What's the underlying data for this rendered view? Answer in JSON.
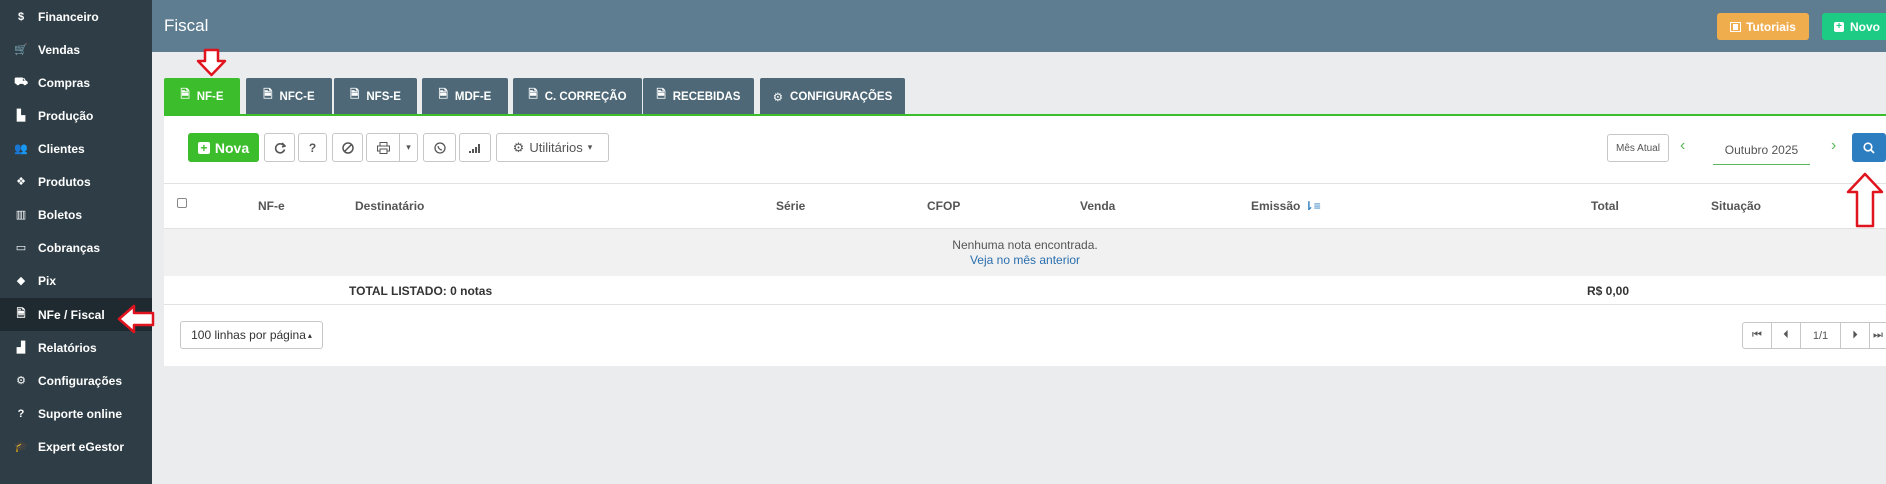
{
  "sidebar": {
    "items": [
      {
        "label": "Financeiro",
        "icon": "$"
      },
      {
        "label": "Vendas",
        "icon": "🛒"
      },
      {
        "label": "Compras",
        "icon": "⛟"
      },
      {
        "label": "Produção",
        "icon": "▙"
      },
      {
        "label": "Clientes",
        "icon": "👥"
      },
      {
        "label": "Produtos",
        "icon": "❖"
      },
      {
        "label": "Boletos",
        "icon": "▥"
      },
      {
        "label": "Cobranças",
        "icon": "▭"
      },
      {
        "label": "Pix",
        "icon": "◆"
      },
      {
        "label": "NFe / Fiscal",
        "icon": "🗎"
      },
      {
        "label": "Relatórios",
        "icon": "▟"
      },
      {
        "label": "Configurações",
        "icon": "⚙"
      },
      {
        "label": "Suporte online",
        "icon": "?"
      },
      {
        "label": "Expert eGestor",
        "icon": "🎓"
      }
    ]
  },
  "header": {
    "title": "Fiscal",
    "tutoriais_label": "Tutoriais",
    "novo_label": "Novo"
  },
  "tabs": [
    {
      "label": "NF-E"
    },
    {
      "label": "NFC-E"
    },
    {
      "label": "NFS-E"
    },
    {
      "label": "MDF-E"
    },
    {
      "label": "C. CORREÇÃO"
    },
    {
      "label": "RECEBIDAS"
    },
    {
      "label": "CONFIGURAÇÕES"
    }
  ],
  "toolbar": {
    "nova_label": "Nova",
    "help_label": "?",
    "utilitarios_label": "Utilitários",
    "mes_atual_label": "Mês Atual",
    "month_value": "Outubro 2025"
  },
  "table": {
    "headers": [
      "NF-e",
      "Destinatário",
      "Série",
      "CFOP",
      "Venda",
      "Emissão",
      "Total",
      "Situação"
    ],
    "empty_message": "Nenhuma nota encontrada.",
    "empty_link": "Veja no mês anterior",
    "total_label": "TOTAL LISTADO: 0 notas",
    "total_value": "R$ 0,00"
  },
  "pagination": {
    "per_page_label": "100 linhas por página",
    "page_indicator": "1/1"
  },
  "colors": {
    "sidebar": "#2f3e46",
    "header": "#5e7d91",
    "tab": "#4e6877",
    "tab_active": "#3cbd2c",
    "tutoriais": "#f0ad4e",
    "novo": "#1ecb84",
    "search": "#2d7dc1",
    "annotation_arrow": "#e0141e"
  }
}
